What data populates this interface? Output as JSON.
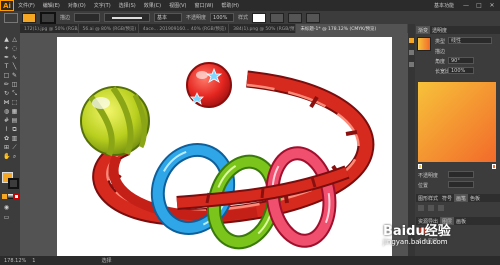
{
  "app": {
    "logo": "Ai"
  },
  "menu": {
    "items": [
      "文件(F)",
      "编辑(E)",
      "对象(O)",
      "文字(T)",
      "选择(S)",
      "效果(C)",
      "视图(V)",
      "窗口(W)",
      "帮助(H)"
    ]
  },
  "window": {
    "workspace": "基本功能",
    "minimize": "—",
    "maximize": "□",
    "close": "✕"
  },
  "controlbar": {
    "stroke_label": "描边",
    "style_label": "基本",
    "opacity_label": "不透明度",
    "opacity_value": "100%",
    "shape_label": "样式"
  },
  "tabs": [
    {
      "label": "172(1).jpg @ 50% (RGB/预览)",
      "active": false
    },
    {
      "label": "56.ai @ 80% (RGB/预览)",
      "active": false
    },
    {
      "label": "4ace... 201909160... 40% (RGB/预览)",
      "active": false
    },
    {
      "label": "384(1).png @ 50% (RGB/预览)",
      "active": false
    },
    {
      "label": "未标题-1* @ 178.12% (CMYK/预览)",
      "active": true
    }
  ],
  "colors": {
    "fill": "#f5a623",
    "stroke": "#000000",
    "accent": "#ff9a00",
    "gradient_start": "#f7c23a",
    "gradient_end": "#f26a2a"
  },
  "right_panel": {
    "panel_tab_1": "渐变",
    "panel_tab_2": "透明度",
    "type_label": "类型",
    "type_value": "线性",
    "stroke_label": "描边",
    "angle_label": "角度",
    "angle_value": "90°",
    "ratio_label": "长宽比",
    "ratio_value": "100%",
    "opacity_label": "不透明度",
    "location_label": "位置",
    "lower_tabs": [
      "图形样式",
      "符号",
      "画笔",
      "色板"
    ],
    "layers_tabs": [
      "资源导出",
      "图层",
      "画板"
    ],
    "layer_count": "1 个图层"
  },
  "status": {
    "zoom": "178.12%",
    "page": "1",
    "mode": "选择"
  },
  "watermark": {
    "brand": "Baidu经验",
    "url": "jingyan.baidu.com"
  }
}
